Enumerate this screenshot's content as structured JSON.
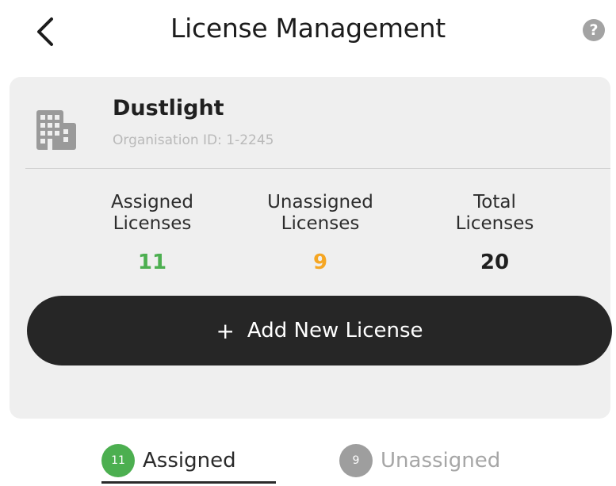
{
  "header": {
    "title": "License Management",
    "back_icon": "chevron-left-icon",
    "help_icon": "question-mark-icon",
    "help_glyph": "?"
  },
  "organisation": {
    "icon": "building-icon",
    "name": "Dustlight",
    "id_text": "Organisation ID: 1-2245"
  },
  "stats": {
    "assigned": {
      "label": "Assigned\nLicenses",
      "value": "11",
      "color": "#4caf50"
    },
    "unassigned": {
      "label": "Unassigned\nLicenses",
      "value": "9",
      "color": "#f5a623"
    },
    "total": {
      "label": "Total\nLicenses",
      "value": "20",
      "color": "#1f1f1f"
    }
  },
  "add_button": {
    "plus": "+",
    "label": "Add New License"
  },
  "tabs": [
    {
      "label": "Assigned",
      "count": "11",
      "badge_color": "#4caf50",
      "active": true
    },
    {
      "label": "Unassigned",
      "count": "9",
      "badge_color": "#9e9e9e",
      "active": false
    }
  ]
}
